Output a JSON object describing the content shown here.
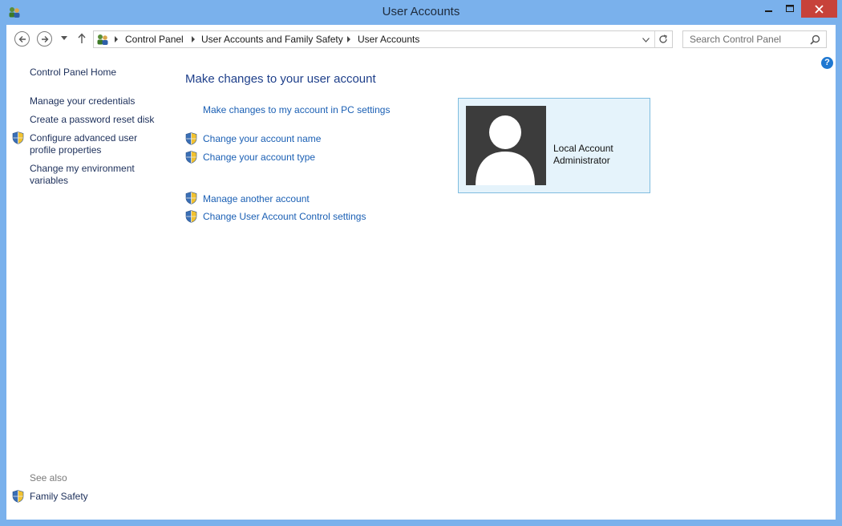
{
  "window": {
    "title": "User Accounts",
    "icon": "user-accounts-icon"
  },
  "caption_buttons": {
    "minimize": "minimize-icon",
    "maximize": "maximize-icon",
    "close": "close-icon"
  },
  "address_bar": {
    "breadcrumb": [
      "Control Panel",
      "User Accounts and Family Safety",
      "User Accounts"
    ]
  },
  "search": {
    "placeholder": "Search Control Panel"
  },
  "sidebar": {
    "home": "Control Panel Home",
    "items": [
      {
        "label": "Manage your credentials",
        "shield": false
      },
      {
        "label": "Create a password reset disk",
        "shield": false
      },
      {
        "label_line1": "Configure advanced user",
        "label_line2": "profile properties",
        "shield": true
      },
      {
        "label_line1": "Change my environment",
        "label_line2": "variables",
        "shield": false
      }
    ],
    "see_also_label": "See also",
    "see_also_items": [
      "Family Safety"
    ]
  },
  "main": {
    "heading": "Make changes to your user account",
    "links": [
      "Make changes to my account in PC settings",
      "Change your account name",
      "Change your account type",
      "Manage another account",
      "Change User Account Control settings"
    ]
  },
  "account": {
    "type": "Local Account",
    "role": "Administrator"
  },
  "help": {
    "label": "?"
  }
}
